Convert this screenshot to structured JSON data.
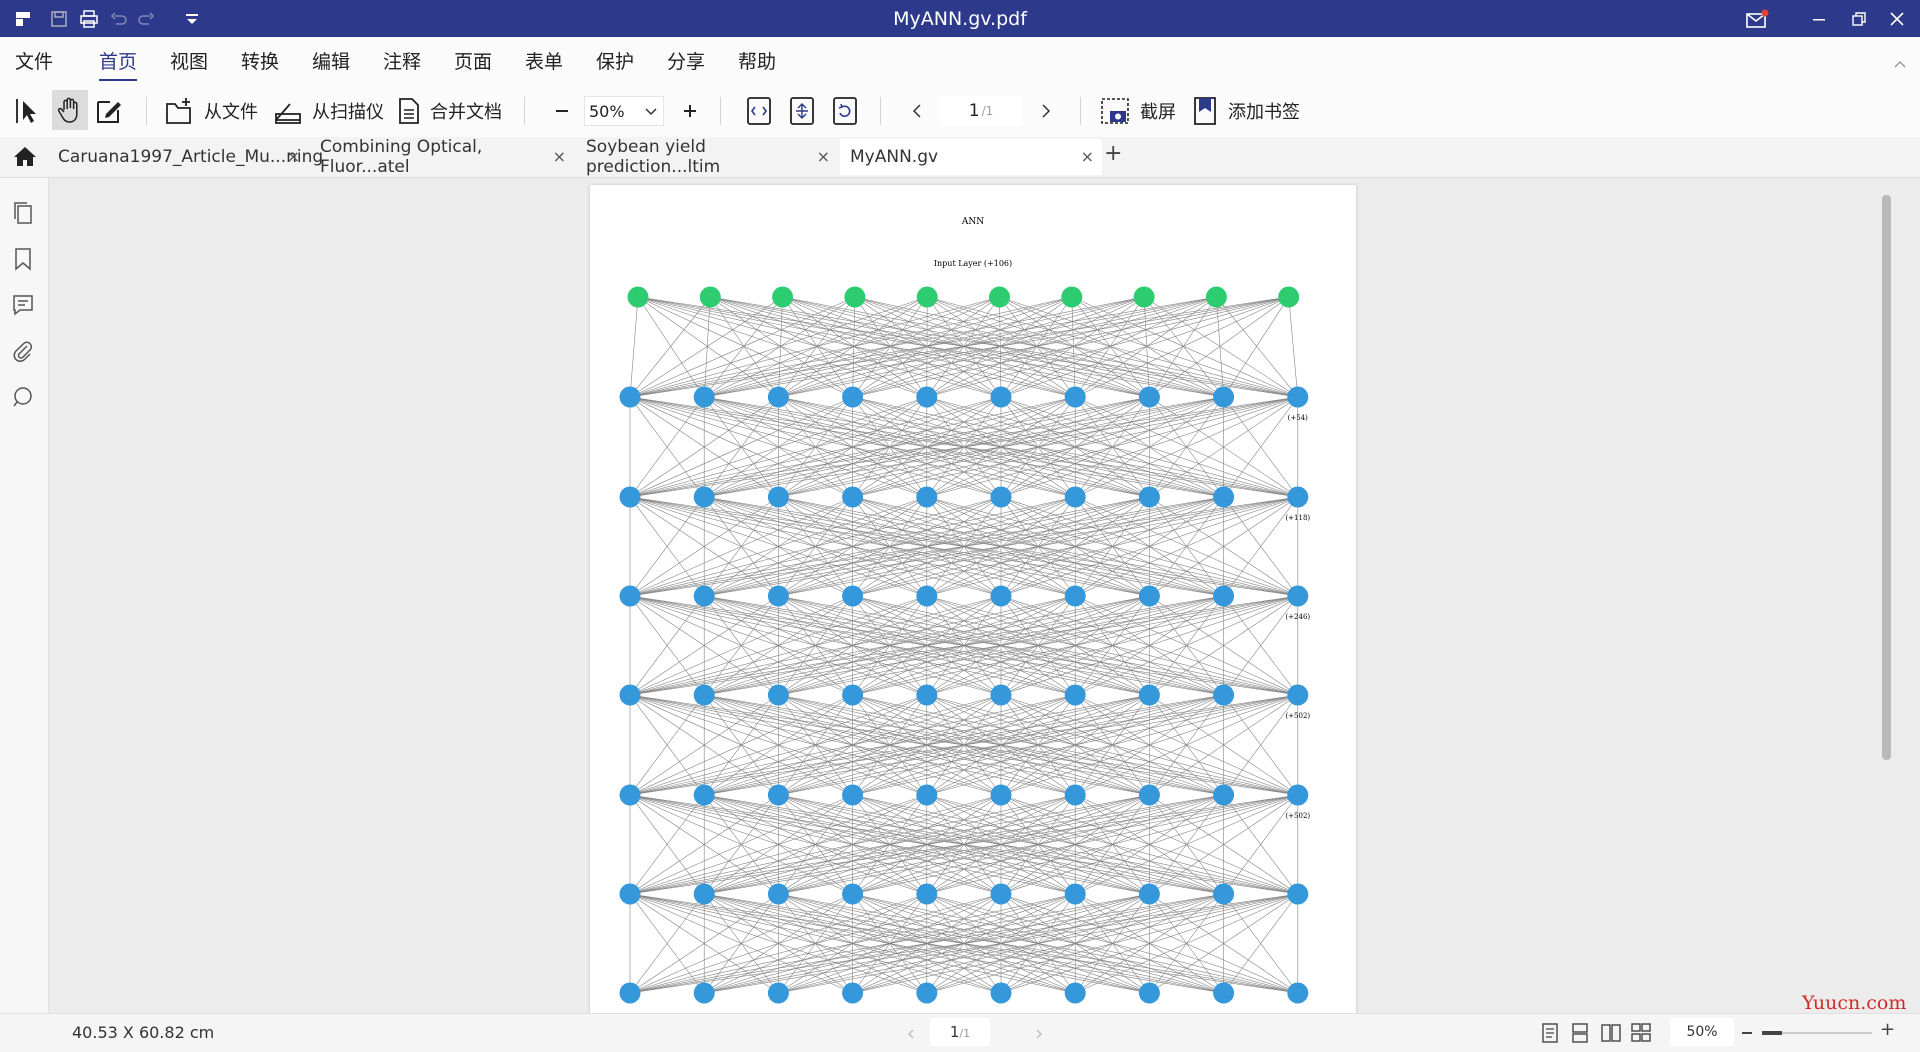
{
  "window": {
    "title": "MyANN.gv.pdf",
    "colors": {
      "titlebar": "#2d3a8c",
      "accent": "#2d3a8c",
      "notify_dot": "#e8432e"
    }
  },
  "menu": {
    "file": "文件",
    "items": [
      "首页",
      "视图",
      "转换",
      "编辑",
      "注释",
      "页面",
      "表单",
      "保护",
      "分享",
      "帮助"
    ],
    "active_index": 0
  },
  "toolbar": {
    "from_file": "从文件",
    "from_scanner": "从扫描仪",
    "merge_docs": "合并文档",
    "zoom_value": "50%",
    "page_current": "1",
    "page_total": "/1",
    "screenshot": "截屏",
    "add_bookmark": "添加书签"
  },
  "tabs": [
    {
      "label": "Caruana1997_Article_Mu...ning"
    },
    {
      "label": "Combining Optical, Fluor...atel"
    },
    {
      "label": "Soybean yield prediction...ltim"
    },
    {
      "label": "MyANN.gv"
    }
  ],
  "tab_close": "×",
  "tab_add": "+",
  "document": {
    "title": "ANN",
    "input_label": "Input Layer (+106)",
    "layer_counts": [
      "(+54)",
      "(+118)",
      "(+246)",
      "(+502)",
      "(+502)"
    ],
    "node_colors": {
      "input": "#2ecc71",
      "hidden": "#3498db"
    }
  },
  "status": {
    "page_size": "40.53 X 60.82 cm",
    "page_current": "1",
    "page_total": "/1",
    "zoom": "50%",
    "watermark": "Yuucn.com"
  }
}
